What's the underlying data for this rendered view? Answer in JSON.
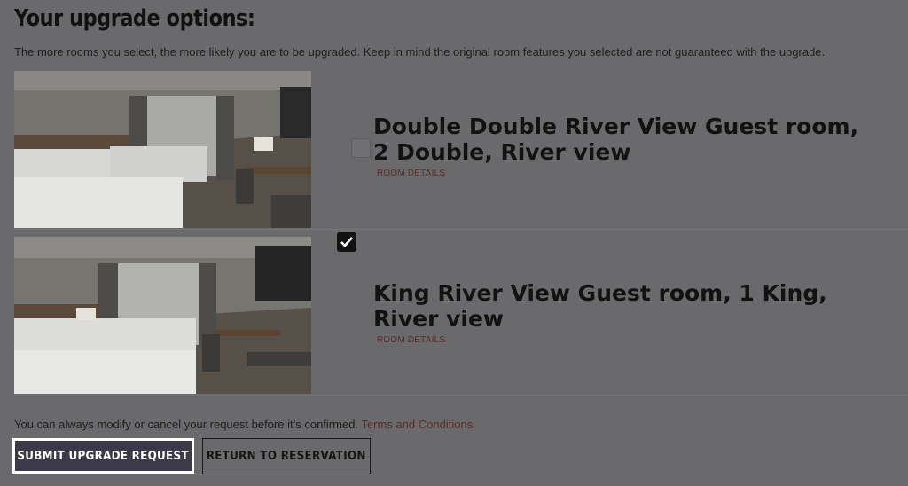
{
  "page": {
    "title": "Your upgrade options:",
    "subtitle": "The more rooms you select, the more likely you are to be upgraded. Keep in mind the original room features you selected are not guaranteed with the upgrade."
  },
  "rooms": [
    {
      "name": "Double Double River View Guest room, 2 Double, River view",
      "details_label": "ROOM DETAILS",
      "selected": false
    },
    {
      "name": "King River View Guest room, 1 King, River view",
      "details_label": "ROOM DETAILS",
      "selected": true
    }
  ],
  "footer": {
    "note": "You can always modify or cancel your request before it’s confirmed.",
    "terms_link": "Terms and Conditions"
  },
  "actions": {
    "submit_label": "SUBMIT UPGRADE REQUEST",
    "return_label": "RETURN TO RESERVATION"
  },
  "colors": {
    "overlay": "#6a6a6d",
    "link": "#5b2c26",
    "submit_bg": "#3c3a49"
  },
  "icons": {
    "checked": "checkmark-icon"
  }
}
